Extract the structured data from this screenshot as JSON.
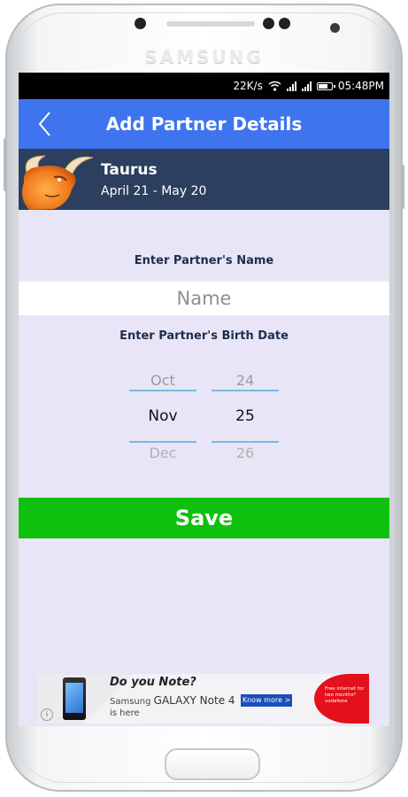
{
  "device": {
    "brand": "SAMSUNG"
  },
  "status_bar": {
    "net_speed": "22K/s",
    "time": "05:48PM"
  },
  "app_bar": {
    "title": "Add Partner Details"
  },
  "sign": {
    "name": "Taurus",
    "dates": "April 21 - May 20"
  },
  "form": {
    "name_label": "Enter Partner's Name",
    "name_placeholder": "Name",
    "name_value": "",
    "birth_label": "Enter Partner's Birth Date",
    "month_picker": {
      "prev": "Oct",
      "current": "Nov",
      "next": "Dec"
    },
    "day_picker": {
      "prev": "24",
      "current": "25",
      "next": "26"
    },
    "save_label": "Save"
  },
  "ad": {
    "headline": "Do you Note?",
    "brand_line_prefix": "Samsung",
    "brand_line_product": "GALAXY Note 4",
    "line3": "is here",
    "cta": "Know more >",
    "promo": "Free internet for two months* vodafone"
  },
  "colors": {
    "app_bar": "#3f74ef",
    "sign_bar": "#2c3f5e",
    "screen_bg": "#e8e6f6",
    "save_button": "#0ec10e",
    "picker_divider": "#7ab8e8"
  },
  "icons": {
    "back": "chevron-left-icon",
    "wifi": "wifi-icon",
    "signal": "signal-bars-icon",
    "battery": "battery-icon",
    "sign": "taurus-bull-icon"
  }
}
